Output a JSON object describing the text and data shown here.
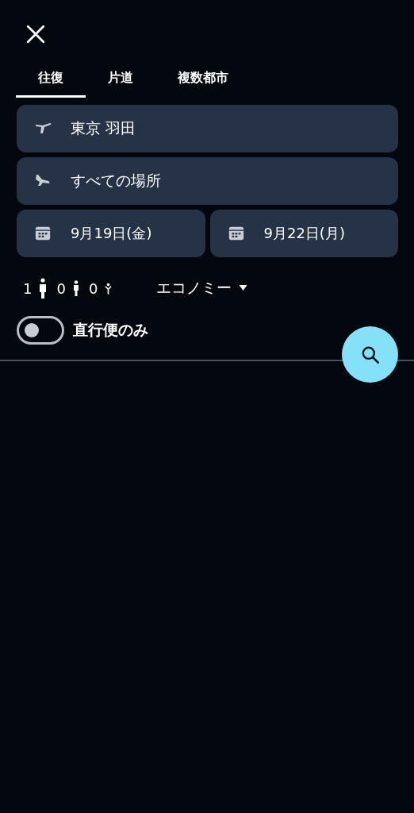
{
  "tabs": [
    {
      "label": "往復",
      "selected": true
    },
    {
      "label": "片道",
      "selected": false
    },
    {
      "label": "複数都市",
      "selected": false
    }
  ],
  "places": [
    {
      "kind": "departure",
      "value": "東京 羽田"
    },
    {
      "kind": "arrival",
      "value": "すべての場所"
    }
  ],
  "dates": [
    {
      "value": "9月19日(金)"
    },
    {
      "value": "9月22日(月)"
    }
  ],
  "passengers": [
    {
      "kind": "adult",
      "count": "1"
    },
    {
      "kind": "child",
      "count": "0"
    },
    {
      "kind": "infant",
      "count": "0"
    }
  ],
  "cabin_class": "エコノミー",
  "direct_only": {
    "label": "直行便のみ",
    "on": false
  }
}
